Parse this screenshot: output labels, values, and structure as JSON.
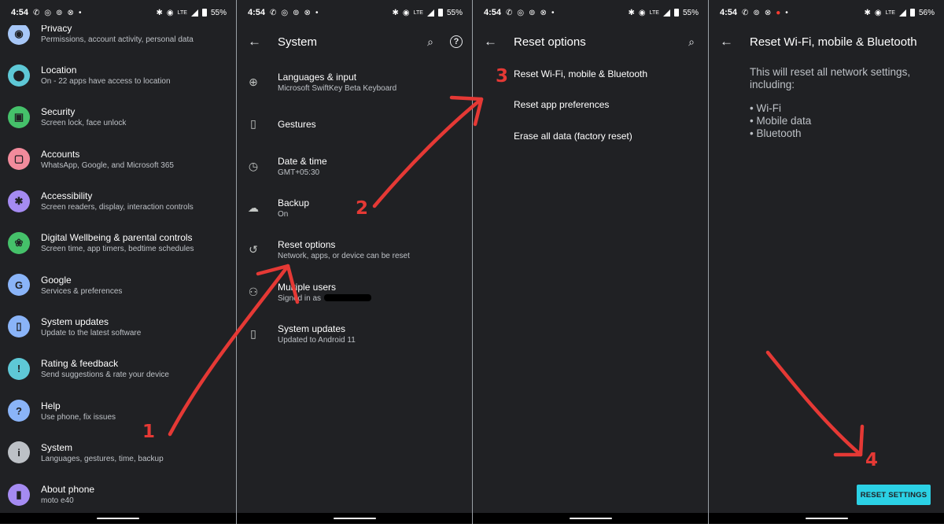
{
  "panels": [
    {
      "status": {
        "time": "4:54",
        "battery": "55%"
      },
      "items": [
        {
          "title": "Privacy",
          "subtitle": "Permissions, account activity, personal data",
          "icon": "eye-icon",
          "color": "#a7c7f7"
        },
        {
          "title": "Location",
          "subtitle": "On - 22 apps have access to location",
          "icon": "location-pin-icon",
          "color": "#5ec8d6"
        },
        {
          "title": "Security",
          "subtitle": "Screen lock, face unlock",
          "icon": "lock-icon",
          "color": "#45c16a"
        },
        {
          "title": "Accounts",
          "subtitle": "WhatsApp, Google, and Microsoft 365",
          "icon": "account-box-icon",
          "color": "#f28b9c"
        },
        {
          "title": "Accessibility",
          "subtitle": "Screen readers, display, interaction controls",
          "icon": "accessibility-icon",
          "color": "#a58bf2"
        },
        {
          "title": "Digital Wellbeing & parental controls",
          "subtitle": "Screen time, app timers, bedtime schedules",
          "icon": "wellbeing-icon",
          "color": "#45c16a"
        },
        {
          "title": "Google",
          "subtitle": "Services & preferences",
          "icon": "google-icon",
          "color": "#8ab4f8"
        },
        {
          "title": "System updates",
          "subtitle": "Update to the latest software",
          "icon": "system-update-icon",
          "color": "#8ab4f8"
        },
        {
          "title": "Rating & feedback",
          "subtitle": "Send suggestions & rate your device",
          "icon": "feedback-icon",
          "color": "#5ec8d6"
        },
        {
          "title": "Help",
          "subtitle": "Use phone, fix issues",
          "icon": "help-icon",
          "color": "#8ab4f8"
        },
        {
          "title": "System",
          "subtitle": "Languages, gestures, time, backup",
          "icon": "info-icon",
          "color": "#bdc1c6"
        },
        {
          "title": "About phone",
          "subtitle": "moto e40",
          "icon": "phone-icon",
          "color": "#a58bf2"
        }
      ]
    },
    {
      "status": {
        "time": "4:54",
        "battery": "55%"
      },
      "title": "System",
      "items": [
        {
          "title": "Languages & input",
          "subtitle": "Microsoft SwiftKey Beta Keyboard",
          "icon": "globe-icon"
        },
        {
          "title": "Gestures",
          "subtitle": "",
          "icon": "gestures-icon"
        },
        {
          "title": "Date & time",
          "subtitle": "GMT+05:30",
          "icon": "clock-icon"
        },
        {
          "title": "Backup",
          "subtitle": "On",
          "icon": "cloud-upload-icon"
        },
        {
          "title": "Reset options",
          "subtitle": "Network, apps, or device can be reset",
          "icon": "history-icon"
        },
        {
          "title": "Multiple users",
          "subtitle": "Signed in as",
          "icon": "person-icon"
        },
        {
          "title": "System updates",
          "subtitle": "Updated to Android 11",
          "icon": "system-update-icon"
        }
      ]
    },
    {
      "status": {
        "time": "4:54",
        "battery": "55%"
      },
      "title": "Reset options",
      "items": [
        {
          "title": "Reset Wi-Fi, mobile & Bluetooth"
        },
        {
          "title": "Reset app preferences"
        },
        {
          "title": "Erase all data (factory reset)"
        }
      ]
    },
    {
      "status": {
        "time": "4:54",
        "battery": "56%"
      },
      "title": "Reset Wi-Fi, mobile & Bluetooth",
      "description": "This will reset all network settings, including:",
      "bullets": [
        "Wi-Fi",
        "Mobile data",
        "Bluetooth"
      ],
      "button": "RESET SETTINGS"
    }
  ],
  "annotations": {
    "step1": "1",
    "step2": "2",
    "step3": "3",
    "step4": "4",
    "color": "#e53935"
  }
}
